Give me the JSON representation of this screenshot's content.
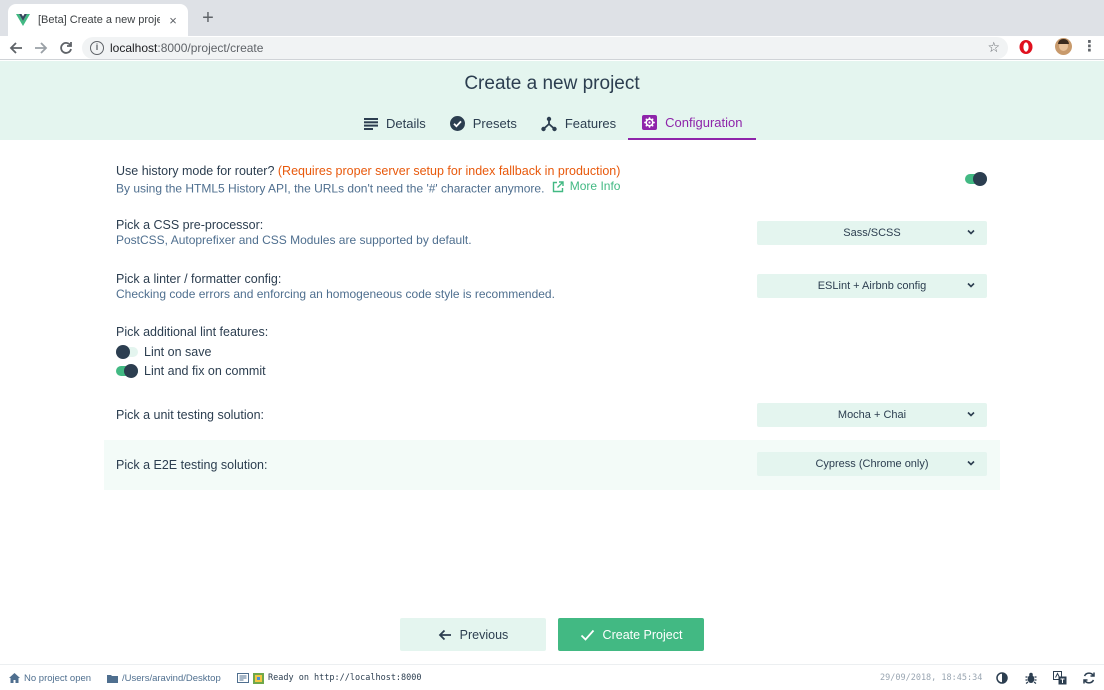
{
  "browser": {
    "tab_title": "[Beta] Create a new project - Vue CLI",
    "url_host": "localhost",
    "url_path": ":8000/project/create"
  },
  "header": {
    "title": "Create a new project",
    "tabs": [
      {
        "label": "Details",
        "icon": "list-icon"
      },
      {
        "label": "Presets",
        "icon": "check-circle-icon"
      },
      {
        "label": "Features",
        "icon": "fork-icon"
      },
      {
        "label": "Configuration",
        "icon": "gear-icon",
        "active": true
      }
    ]
  },
  "config": {
    "history": {
      "title": "Use history mode for router?",
      "warning": "(Requires proper server setup for index fallback in production)",
      "desc": "By using the HTML5 History API, the URLs don't need the '#' character anymore.",
      "more": "More Info",
      "enabled": true
    },
    "css": {
      "title": "Pick a CSS pre-processor:",
      "desc": "PostCSS, Autoprefixer and CSS Modules are supported by default.",
      "value": "Sass/SCSS"
    },
    "linter": {
      "title": "Pick a linter / formatter config:",
      "desc": "Checking code errors and enforcing an homogeneous code style is recommended.",
      "value": "ESLint + Airbnb config"
    },
    "lint_features": {
      "title": "Pick additional lint features:",
      "options": [
        {
          "label": "Lint on save",
          "enabled": false
        },
        {
          "label": "Lint and fix on commit",
          "enabled": true
        }
      ]
    },
    "unit": {
      "title": "Pick a unit testing solution:",
      "value": "Mocha + Chai"
    },
    "e2e": {
      "title": "Pick a E2E testing solution:",
      "value": "Cypress (Chrome only)"
    }
  },
  "actions": {
    "previous": "Previous",
    "create": "Create Project"
  },
  "statusbar": {
    "project": "No project open",
    "folder": "/Users/aravind/Desktop",
    "log": "Ready on http://localhost:8000",
    "datetime": "29/09/2018, 18:45:34"
  },
  "colors": {
    "accent": "#42b983",
    "dark": "#2c3e50",
    "active_tab": "#8e24aa",
    "warning": "#e8590c",
    "header_bg": "#e4f5ef"
  }
}
